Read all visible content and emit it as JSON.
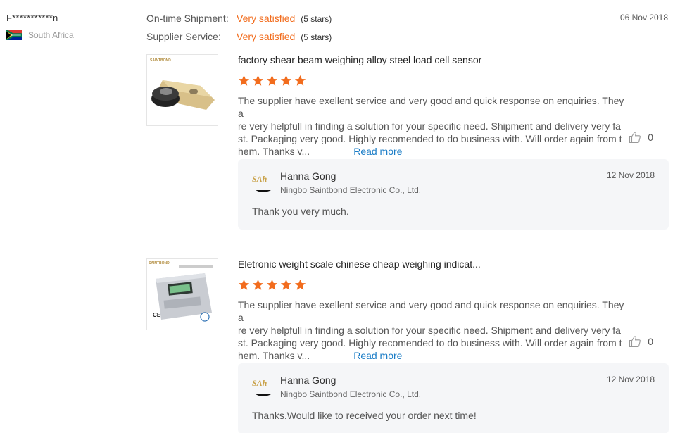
{
  "buyer": {
    "name": "F***********n",
    "country": "South Africa",
    "flag_icon": "south-africa-flag-icon"
  },
  "ratings": [
    {
      "label": "On-time Shipment:",
      "value": "Very satisfied",
      "stars_text": "(5 stars)"
    },
    {
      "label": "Supplier Service:",
      "value": "Very satisfied",
      "stars_text": "(5 stars)"
    }
  ],
  "review_date": "06 Nov 2018",
  "colors": {
    "accent": "#f26c1d",
    "link": "#1a7cc6",
    "reply_bg": "#f5f6f8"
  },
  "products": [
    {
      "title": "factory shear beam weighing alloy steel load cell sensor",
      "stars": 5,
      "thumb_brand": "SAINTBOND",
      "review_lines": [
        "The supplier have exellent service and very good and quick response on enquiries. They a",
        "re very helpfull in finding a solution for your specific need. Shipment and delivery very fa",
        "st. Packaging very good. Highly recomended to do business with. Will order again from t",
        "hem. Thanks v..."
      ],
      "read_more": "Read more",
      "likes": "0",
      "reply": {
        "name": "Hanna Gong",
        "company": "Ningbo Saintbond Electronic Co., Ltd.",
        "date": "12 Nov 2018",
        "text": "Thank you very much."
      }
    },
    {
      "title": "Eletronic weight scale chinese cheap weighing indicat...",
      "stars": 5,
      "thumb_brand": "SAINTBOND",
      "review_lines": [
        "The supplier have exellent service and very good and quick response on enquiries. They a",
        "re very helpfull in finding a solution for your specific need. Shipment and delivery very fa",
        "st. Packaging very good. Highly recomended to do business with. Will order again from t",
        "hem. Thanks v..."
      ],
      "read_more": "Read more",
      "likes": "0",
      "reply": {
        "name": "Hanna Gong",
        "company": "Ningbo Saintbond Electronic Co., Ltd.",
        "date": "12 Nov 2018",
        "text": "Thanks.Would like to received your order next time!"
      }
    }
  ]
}
